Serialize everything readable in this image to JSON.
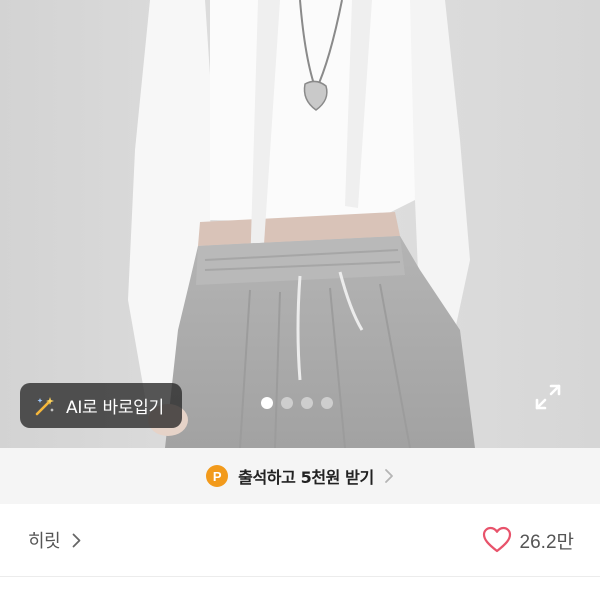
{
  "product_image": {
    "alt": "",
    "carousel": {
      "total": 4,
      "active_index": 0
    }
  },
  "ai_button": {
    "label": "AI로 바로입기",
    "icon": "magic-wand-icon"
  },
  "expand_button": {
    "icon": "expand-icon"
  },
  "attendance_banner": {
    "badge": "P",
    "text": "출석하고 5천원 받기",
    "badge_color": "#f29a1b"
  },
  "store": {
    "name": "히릿"
  },
  "likes": {
    "count": "26.2만",
    "heart_color": "#e8536b"
  }
}
